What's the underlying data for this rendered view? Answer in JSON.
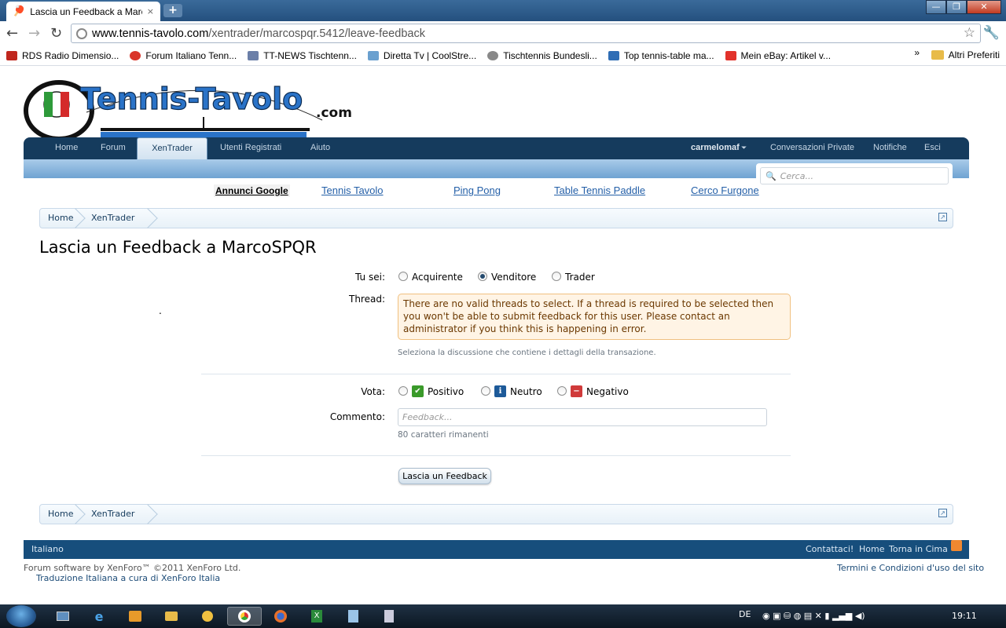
{
  "browser": {
    "tab_title": "Lascia un Feedback a Marco",
    "tab_close": "×",
    "new_tab": "+",
    "url_domain": "www.tennis-tavolo.com",
    "url_path": "/xentrader/marcospqr.5412/leave-feedback",
    "back": "←",
    "forward": "→",
    "reload": "↻",
    "star": "☆",
    "wrench": "🔧",
    "win_min": "—",
    "win_max": "❐",
    "win_close": "✕"
  },
  "bookmarks": {
    "items": [
      {
        "label": "RDS Radio Dimensio...",
        "color": "#c0271e"
      },
      {
        "label": "Forum Italiano Tenn...",
        "color": "#d9352a"
      },
      {
        "label": "TT-NEWS Tischtenn...",
        "color": "#6b7fa8"
      },
      {
        "label": "Diretta Tv | CoolStre...",
        "color": "#6aa0cf"
      },
      {
        "label": "Tischtennis Bundesli...",
        "color": "#888888"
      },
      {
        "label": "Top tennis-table ma...",
        "color": "#2f6db5"
      },
      {
        "label": "Mein eBay: Artikel v...",
        "color": "#e2322b"
      }
    ],
    "chevron": "»",
    "other": "Altri Preferiti"
  },
  "site": {
    "logo_text": "Tennis-Tavolo",
    "logo_com": ".com",
    "nav": {
      "home": "Home",
      "forum": "Forum",
      "xentrader": "XenTrader",
      "users": "Utenti Registrati",
      "help": "Aiuto",
      "username": "carmelomaf",
      "conversations": "Conversazioni Private",
      "notifications": "Notifiche",
      "logout": "Esci"
    },
    "search_placeholder": "Cerca...",
    "ads": {
      "label": "Annunci Google",
      "links": [
        "Tennis Tavolo",
        "Ping Pong",
        "Table Tennis Paddle",
        "Cerco Furgone"
      ]
    },
    "breadcrumbs": [
      "Home",
      "XenTrader"
    ],
    "page_title": "Lascia un Feedback a MarcoSPQR",
    "form": {
      "role_label": "Tu sei:",
      "roles": [
        "Acquirente",
        "Venditore",
        "Trader"
      ],
      "selected_role": "Venditore",
      "thread_label": "Thread:",
      "thread_error": "There are no valid threads to select. If a thread is required to be selected then you won't be able to submit feedback for this user. Please contact an administrator if you think this is happening in error.",
      "thread_hint": "Seleziona la discussione che contiene i dettagli della transazione.",
      "vote_label": "Vota:",
      "votes": [
        "Positivo",
        "Neutro",
        "Negativo"
      ],
      "vote_icons": [
        "✔",
        "i",
        "−"
      ],
      "comment_label": "Commento:",
      "comment_placeholder": "Feedback...",
      "chars_remaining": "80 caratteri rimanenti",
      "submit": "Lascia un Feedback",
      "dot": "."
    },
    "footer": {
      "language": "Italiano",
      "contact": "Contattaci!",
      "home": "Home",
      "top": "Torna in Cima",
      "software": "Forum software by XenForo™ ©2011 XenForo Ltd.",
      "translation_prefix": "Traduzione Italiana a cura di ",
      "translation_link": "XenForo Italia",
      "terms": "Termini e Condizioni d'uso del sito"
    }
  },
  "taskbar": {
    "language": "DE",
    "time": "19:11"
  },
  "colors": {
    "nav_dark": "#153b5d",
    "link_blue": "#2560a8",
    "error_bg": "#fff4e5",
    "vote_positive": "#3a9a2a",
    "vote_neutral": "#1d5a99",
    "vote_negative": "#d03a3a"
  }
}
